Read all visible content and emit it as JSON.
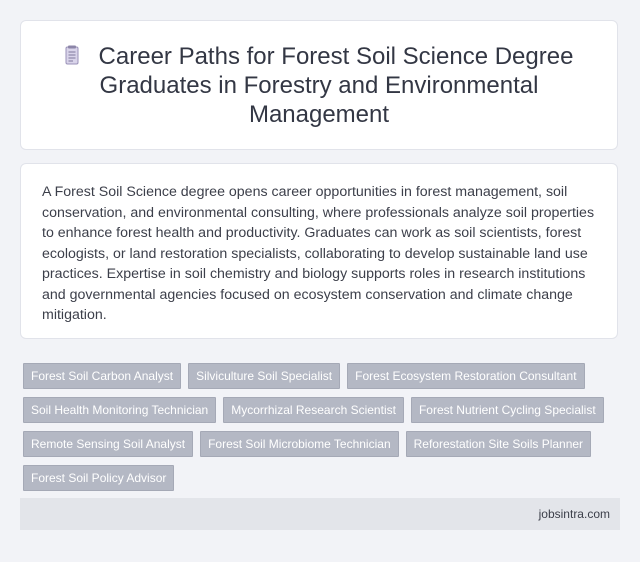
{
  "header": {
    "icon": "document-icon",
    "title": "Career Paths for Forest Soil Science Degree Graduates in Forestry and Environmental Management"
  },
  "description": "A Forest Soil Science degree opens career opportunities in forest management, soil conservation, and environmental consulting, where professionals analyze soil properties to enhance forest health and productivity. Graduates can work as soil scientists, forest ecologists, or land restoration specialists, collaborating to develop sustainable land use practices. Expertise in soil chemistry and biology supports roles in research institutions and governmental agencies focused on ecosystem conservation and climate change mitigation.",
  "tags": [
    "Forest Soil Carbon Analyst",
    "Silviculture Soil Specialist",
    "Forest Ecosystem Restoration Consultant",
    "Soil Health Monitoring Technician",
    "Mycorrhizal Research Scientist",
    "Forest Nutrient Cycling Specialist",
    "Remote Sensing Soil Analyst",
    "Forest Soil Microbiome Technician",
    "Reforestation Site Soils Planner",
    "Forest Soil Policy Advisor"
  ],
  "footer": {
    "site": "jobsintra.com"
  },
  "colors": {
    "background": "#f2f3f7",
    "tag_background": "#b4b8c4",
    "footer_background": "#e3e5ea"
  }
}
